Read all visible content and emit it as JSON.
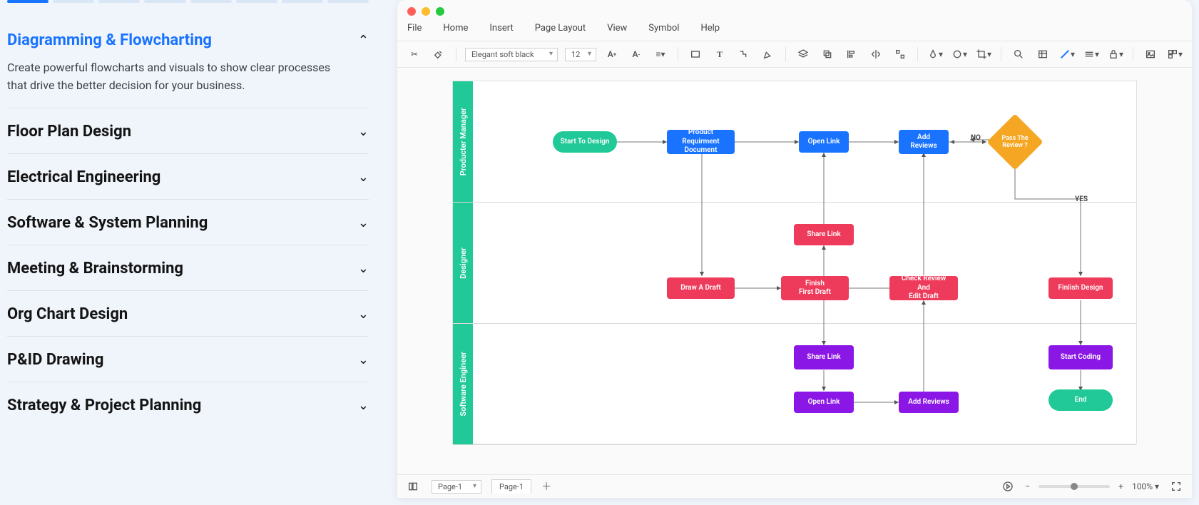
{
  "sidebar": {
    "progress_segments": 8,
    "active_segment": 0,
    "items": [
      {
        "title": "Diagramming & Flowcharting",
        "expanded": true,
        "body": "Create powerful flowcharts and visuals to show clear processes that drive the better decision for your business."
      },
      {
        "title": "Floor Plan Design",
        "expanded": false
      },
      {
        "title": "Electrical Engineering",
        "expanded": false
      },
      {
        "title": "Software & System Planning",
        "expanded": false
      },
      {
        "title": "Meeting & Brainstorming",
        "expanded": false
      },
      {
        "title": "Org Chart Design",
        "expanded": false
      },
      {
        "title": "P&ID Drawing",
        "expanded": false
      },
      {
        "title": "Strategy & Project Planning",
        "expanded": false
      }
    ]
  },
  "menubar": [
    "File",
    "Home",
    "Insert",
    "Page Layout",
    "View",
    "Symbol",
    "Help"
  ],
  "toolbar": {
    "font": "Elegant soft black",
    "font_size": "12"
  },
  "swimlanes": [
    "Producter Manager",
    "Designer",
    "Software Engineer"
  ],
  "nodes": {
    "start": "Start To Design",
    "reqdoc_l1": "Product Requirment",
    "reqdoc_l2": "Document",
    "openlink1": "Open Link",
    "addrev1_l1": "Add",
    "addrev1_l2": "Reviews",
    "decision_l1": "Pass The",
    "decision_l2": "Review ?",
    "sharelink1": "Share Link",
    "draft": "Draw A Draft",
    "finishdraft_l1": "Finish",
    "finishdraft_l2": "First Draft",
    "checkrev_l1": "Check Review And",
    "checkrev_l2": "Edit Draft",
    "finishdesign": "Finlish Design",
    "sharelink2": "Share Link",
    "openlink2": "Open Link",
    "addrev2": "Add Reviews",
    "startcoding": "Start Coding",
    "end": "End"
  },
  "edge_labels": {
    "no": "NO",
    "yes": "YES"
  },
  "statusbar": {
    "page_selector": "Page-1",
    "page_tab": "Page-1",
    "zoom": "100%"
  }
}
